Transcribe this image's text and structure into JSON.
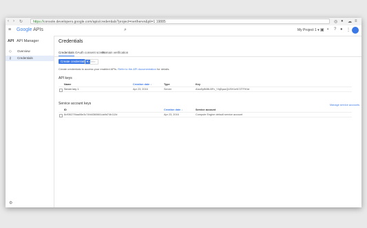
{
  "browser": {
    "address_secure": "https://",
    "address_rest": "console.developers.google.com/apis/credentials?project=nerthervn&pli=1 19885"
  },
  "topbar": {
    "logo_brand": "Google",
    "logo_product": " APIs",
    "project_label": "My Project 1 ▾"
  },
  "sidebar": {
    "title_abbr": "API",
    "title": "API Manager",
    "items": [
      {
        "icon": "overview-icon",
        "label": "Overview"
      },
      {
        "icon": "key-icon",
        "label": "Credentials"
      }
    ]
  },
  "main": {
    "title": "Credentials",
    "tabs": [
      "Credentials",
      "OAuth consent screen",
      "Domain verification"
    ],
    "create_button": "Create credentials ▾",
    "delete_button": "Delete",
    "description_text": "Create credentials to access your enabled APIs. ",
    "description_link": "Refer to the API documentation",
    "description_tail": " for details.",
    "api_keys": {
      "heading": "API keys",
      "headers": {
        "name": "Name",
        "created": "Creation date ↓",
        "type": "Type",
        "key": "Key"
      },
      "rows": [
        {
          "name": "Server key 1",
          "created": "Apr 23, 2016",
          "type": "Server",
          "key": "AIzaSyB6BLBFv_YbjDyazQUSH1eN7ZTFIKtd"
        }
      ]
    },
    "service_accounts": {
      "heading": "Service account keys",
      "manage_link": "Manage service accounts",
      "headers": {
        "id": "ID",
        "created": "Creation date ↓",
        "account": "Service account"
      },
      "rows": [
        {
          "id": "8c93627f4aa06e3c74fd4360661da9d74b112d",
          "created": "Apr 23, 2016",
          "account": "Compute Engine default service account"
        }
      ]
    }
  },
  "colors": {
    "accent": "#3b78e7",
    "sidebar_active": "#e4ecfa"
  }
}
